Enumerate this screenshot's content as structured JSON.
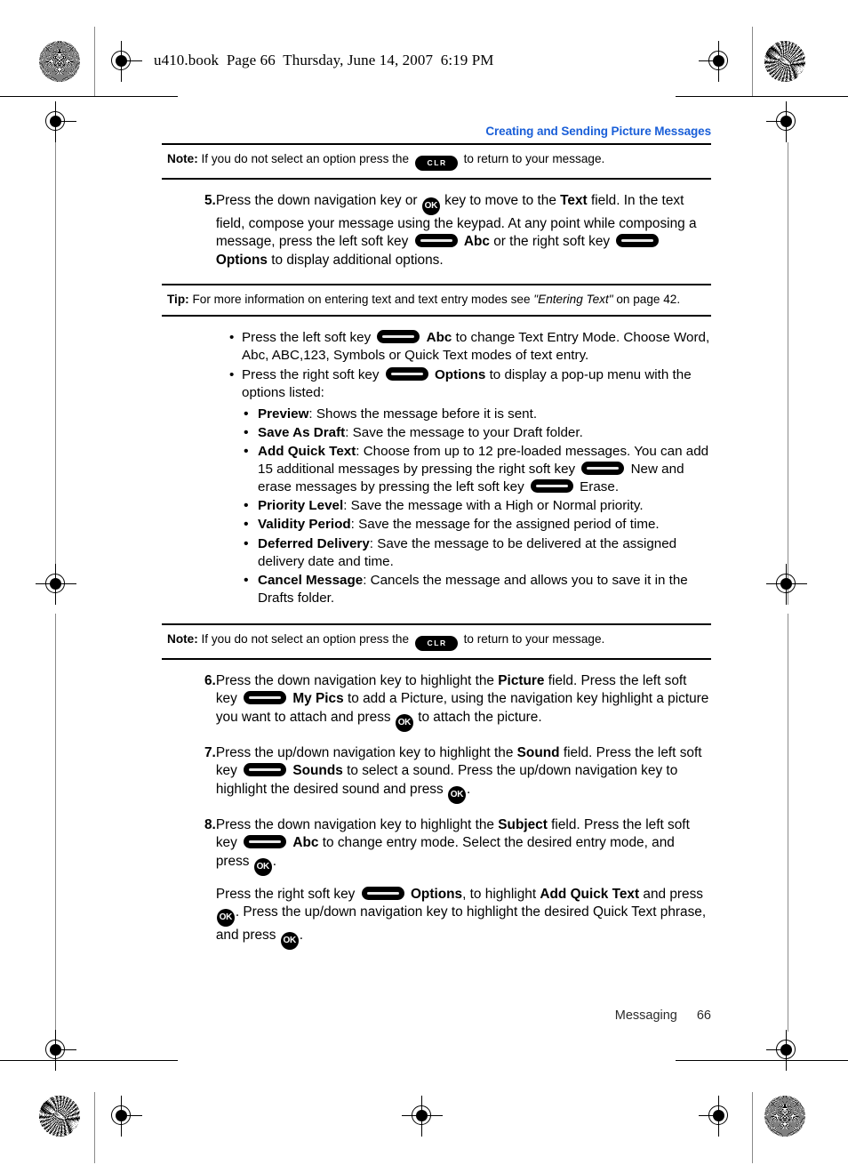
{
  "running_head": "u410.book  Page 66  Thursday, June 14, 2007  6:19 PM",
  "chapter_title": "Creating and Sending Picture Messages",
  "accent_color": "#1a5fd8",
  "keys": {
    "ok_label": "OK",
    "clr_label": "CLR",
    "softkey_label": ""
  },
  "note_top": {
    "label": "Note:",
    "text_before": "If you do not select an option press the",
    "text_after": "to return to your message."
  },
  "step5": {
    "number": "5.",
    "t1": "Press the down navigation key or",
    "t2": "key to move to the",
    "b1": "Text",
    "t3": "field. In the text field, compose your message using the keypad. At any point while composing a message, press the left soft key",
    "b2": "Abc",
    "t4": "or the right soft key",
    "b3": "Options",
    "t5": "to display additional options."
  },
  "tip": {
    "label": "Tip:",
    "text_before": "For more information on entering text and text entry modes see",
    "italic": "\"Entering Text\"",
    "text_after": "on page 42."
  },
  "bullets": [
    {
      "mark": "•",
      "t1": "Press the left soft key",
      "b1": "Abc",
      "t2": "to change Text Entry Mode. Choose Word, Abc, ABC,123, Symbols or Quick Text modes of text entry."
    },
    {
      "mark": "•",
      "t1": "Press the right soft key",
      "b1": "Options",
      "t2": "to display a pop-up menu with the options listed:"
    }
  ],
  "options": [
    {
      "mark": "•",
      "title": "Preview",
      "desc": ": Shows the message before it is sent."
    },
    {
      "mark": "•",
      "title": "Save As Draft",
      "desc": ": Save the message to your Draft folder."
    },
    {
      "mark": "•",
      "title": "Add Quick Text",
      "desc": ": Choose from up to 12 pre-loaded messages. You can add 15 additional messages by pressing the right soft key",
      "desc2": "New and erase messages by pressing the left soft key",
      "desc3": "Erase."
    },
    {
      "mark": "•",
      "title": "Priority Level",
      "desc": ": Save the message with a High or Normal priority."
    },
    {
      "mark": "•",
      "title": "Validity Period",
      "desc": ": Save the message for the assigned period of time."
    },
    {
      "mark": "•",
      "title": "Deferred Delivery",
      "desc": ": Save the message to be delivered at the assigned delivery date and time."
    },
    {
      "mark": "•",
      "title": "Cancel Message",
      "desc": ": Cancels the message and allows you to save it in the Drafts folder."
    }
  ],
  "note_bottom": {
    "label": "Note:",
    "text_before": "If you do not select an option press the",
    "text_after": "to return to your message."
  },
  "step6": {
    "number": "6.",
    "t1": "Press the down navigation key to highlight the",
    "b1": "Picture",
    "t2": "field. Press the left soft key",
    "b2": "My Pics",
    "t3": "to add a Picture, using the navigation key highlight a picture you want to attach and press",
    "t4": "to attach the picture."
  },
  "step7": {
    "number": "7.",
    "t1": "Press the up/down navigation key to highlight the",
    "b1": "Sound",
    "t2": "field. Press the left soft key",
    "b2": "Sounds",
    "t3": "to select a sound. Press the up/down navigation key to highlight the desired sound and press",
    "t4": "."
  },
  "step8": {
    "number": "8.",
    "t1": "Press the down navigation key to highlight the",
    "b1": "Subject",
    "t2": "field. Press the left soft key",
    "b2": "Abc",
    "t3": "to change entry mode. Select the desired entry mode, and press",
    "t4": ".",
    "p2_t1": "Press the right soft key",
    "p2_b1": "Options",
    "p2_t2": ", to highlight",
    "p2_b2": "Add Quick Text",
    "p2_t3": "and press",
    "p2_t4": ". Press the up/down navigation key to highlight the desired Quick Text phrase, and press",
    "p2_t5": "."
  },
  "footer": {
    "section": "Messaging",
    "page": "66"
  }
}
